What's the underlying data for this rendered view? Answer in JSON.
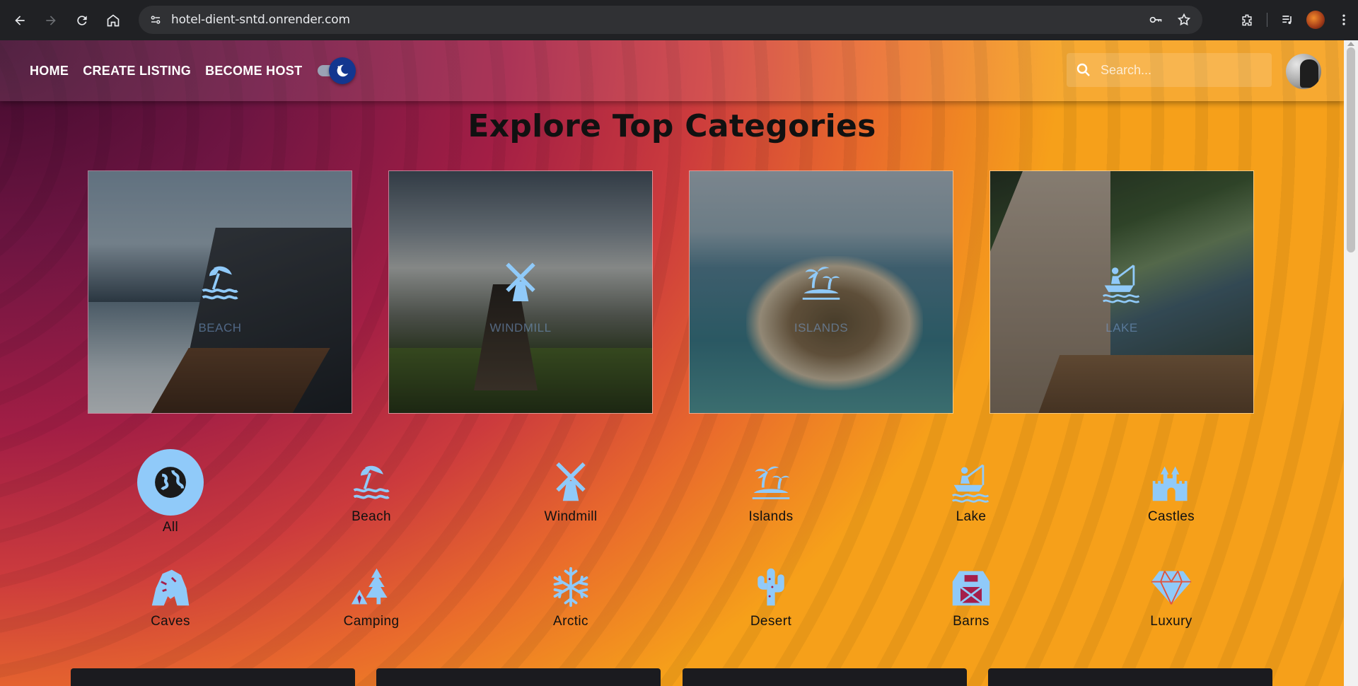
{
  "browser": {
    "url": "hotel-dient-sntd.onrender.com"
  },
  "nav": {
    "home": "HOME",
    "create_listing": "CREATE LISTING",
    "become_host": "BECOME HOST"
  },
  "search": {
    "placeholder": "Search..."
  },
  "page": {
    "title": "Explore Top Categories"
  },
  "top_categories": [
    {
      "label": "BEACH",
      "icon": "beach-umbrella-icon"
    },
    {
      "label": "WINDMILL",
      "icon": "windmill-icon"
    },
    {
      "label": "ISLANDS",
      "icon": "palm-island-icon"
    },
    {
      "label": "LAKE",
      "icon": "fishing-icon"
    }
  ],
  "categories": [
    {
      "label": "All",
      "icon": "globe-icon",
      "active": true
    },
    {
      "label": "Beach",
      "icon": "beach-umbrella-icon"
    },
    {
      "label": "Windmill",
      "icon": "windmill-icon"
    },
    {
      "label": "Islands",
      "icon": "palm-island-icon"
    },
    {
      "label": "Lake",
      "icon": "fishing-icon"
    },
    {
      "label": "Castles",
      "icon": "castle-icon"
    },
    {
      "label": "Caves",
      "icon": "cave-icon"
    },
    {
      "label": "Camping",
      "icon": "camping-icon"
    },
    {
      "label": "Arctic",
      "icon": "snowflake-icon"
    },
    {
      "label": "Desert",
      "icon": "cactus-icon"
    },
    {
      "label": "Barns",
      "icon": "barn-icon"
    },
    {
      "label": "Luxury",
      "icon": "diamond-icon"
    }
  ],
  "colors": {
    "accent": "#90caf9",
    "toggle_thumb": "#13368f"
  }
}
